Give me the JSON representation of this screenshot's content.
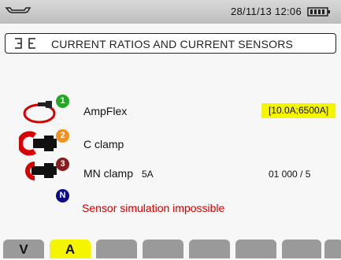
{
  "status": {
    "datetime": "28/11/13 12:06"
  },
  "screen": {
    "title": "CURRENT RATIOS AND CURRENT SENSORS"
  },
  "sensors": [
    {
      "number": "1",
      "name": "AmpFlex",
      "range": "[10.0A;6500A]",
      "badge_color": "#22a822"
    },
    {
      "number": "2",
      "name": "C clamp",
      "badge_color": "#f0901e"
    },
    {
      "number": "3",
      "name": "MN clamp",
      "rating": "5A",
      "ratio": "01 000 / 5",
      "badge_color": "#8b1a1a"
    },
    {
      "number": "N",
      "message": "Sensor simulation impossible",
      "badge_color": "#0a0a8a"
    }
  ],
  "softkeys": [
    {
      "label": "V",
      "active": false
    },
    {
      "label": "A",
      "active": true
    },
    {
      "label": "",
      "active": false
    },
    {
      "label": "",
      "active": false
    },
    {
      "label": "",
      "active": false
    },
    {
      "label": "",
      "active": false
    },
    {
      "label": "",
      "active": false
    },
    {
      "label": "",
      "active": false
    }
  ]
}
